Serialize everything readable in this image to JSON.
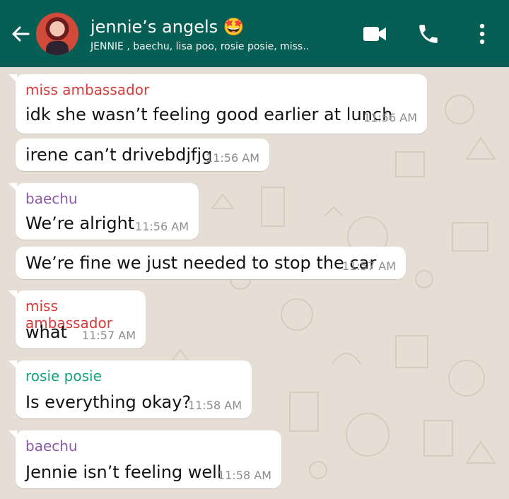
{
  "header": {
    "title": "jennie’s angels 🤩",
    "subtitle": "JENNIE , baechu, lisa poo, rosie posie, miss‥"
  },
  "messages": [
    {
      "sender": "miss ambassador",
      "sender_color": "#d83a3a",
      "text": "idk she wasn’t feeling good earlier at lunch",
      "time": "11:56 AM"
    },
    {
      "sender": "",
      "text": "irene can’t drivebdjfjg",
      "time": "11:56 AM"
    },
    {
      "sender": "baechu",
      "sender_color": "#8b5aa8",
      "text": "We’re alright",
      "time": "11:56 AM"
    },
    {
      "sender": "",
      "text": "We’re fine we just needed to stop the car",
      "time": "11:57 AM"
    },
    {
      "sender": "miss ambassador",
      "sender_color": "#d83a3a",
      "text": "what",
      "time": "11:57 AM"
    },
    {
      "sender": "rosie posie",
      "sender_color": "#15a37a",
      "text": "Is everything okay?",
      "time": "11:58 AM"
    },
    {
      "sender": "baechu",
      "sender_color": "#8b5aa8",
      "text": "Jennie isn’t feeling well",
      "time": "11:58 AM"
    }
  ],
  "icons": {
    "back": "arrow-left-icon",
    "video": "video-call-icon",
    "call": "phone-icon",
    "menu": "more-vertical-icon"
  },
  "colors": {
    "header": "#075e54",
    "chat_bg": "#e6ddd4",
    "bubble": "#ffffff",
    "timestamp": "#8c8c8c"
  }
}
